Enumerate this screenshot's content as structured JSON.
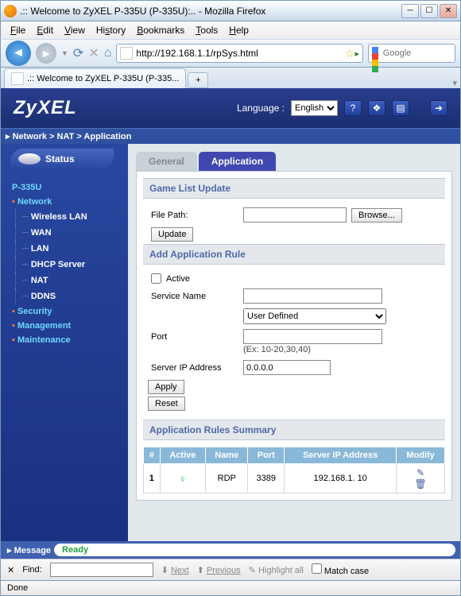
{
  "window": {
    "title": ".:: Welcome to ZyXEL P-335U (P-335U):.. - Mozilla Firefox"
  },
  "menubar": [
    "File",
    "Edit",
    "View",
    "History",
    "Bookmarks",
    "Tools",
    "Help"
  ],
  "url": "http://192.168.1.1/rpSys.html",
  "search_placeholder": "Google",
  "browser_tab": ".:: Welcome to ZyXEL P-335U (P-335...",
  "header": {
    "logo": "ZyXEL",
    "language_label": "Language :",
    "language_value": "English"
  },
  "breadcrumb": "Network > NAT > Application",
  "sidebar": {
    "status": "Status",
    "root": "P-335U",
    "sections": [
      {
        "label": "Network",
        "expanded": true,
        "items": [
          "Wireless LAN",
          "WAN",
          "LAN",
          "DHCP Server",
          "NAT",
          "DDNS"
        ]
      },
      {
        "label": "Security",
        "expanded": false
      },
      {
        "label": "Management",
        "expanded": false
      },
      {
        "label": "Maintenance",
        "expanded": false
      }
    ]
  },
  "tabs": {
    "general": "General",
    "application": "Application"
  },
  "sections": {
    "game_list": "Game List Update",
    "add_rule": "Add Application Rule",
    "summary": "Application Rules Summary"
  },
  "form": {
    "file_path_label": "File Path:",
    "file_path_value": "",
    "browse": "Browse...",
    "update": "Update",
    "active_label": "Active",
    "service_name_label": "Service Name",
    "service_name_value": "",
    "service_select": "User Defined",
    "port_label": "Port",
    "port_value": "",
    "port_hint": "(Ex: 10-20,30,40)",
    "server_ip_label": "Server IP Address",
    "server_ip_value": "0.0.0.0",
    "apply": "Apply",
    "reset": "Reset"
  },
  "table": {
    "headers": [
      "#",
      "Active",
      "Name",
      "Port",
      "Server IP Address",
      "Modify"
    ],
    "rows": [
      {
        "num": "1",
        "active": true,
        "name": "RDP",
        "port": "3389",
        "ip": "192.168.1. 10"
      }
    ]
  },
  "message": {
    "label": "Message",
    "value": "Ready"
  },
  "findbar": {
    "close": "✕",
    "label": "Find:",
    "value": "",
    "next": "Next",
    "previous": "Previous",
    "highlight": "Highlight all",
    "match": "Match case"
  },
  "statusbar": "Done"
}
